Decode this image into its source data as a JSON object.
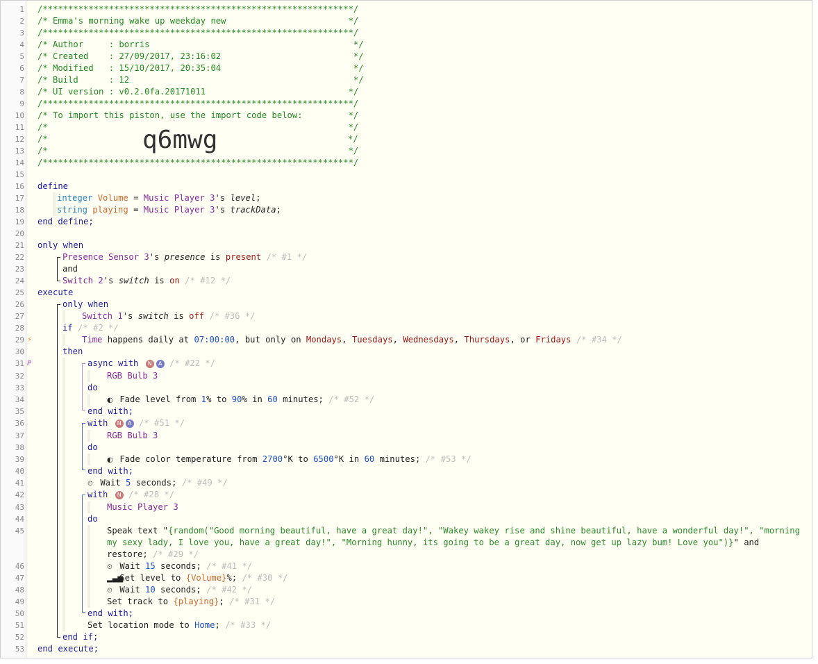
{
  "header": {
    "stars": "/*************************************************************/",
    "title": "/* Emma's morning wake up weekday new                        */",
    "author": "/* Author     : borris                                        */",
    "created": "/* Created    : 27/09/2017, 23:16:02                          */",
    "modified": "/* Modified   : 15/10/2017, 20:35:04                          */",
    "build": "/* Build      : 12                                            */",
    "ui_version": "/* UI version : v0.2.0fa.20171011                            */",
    "import_note": "/* To import this piston, use the import code below:         */",
    "empty_comment": "/*                                                           */",
    "import_prefix": "/*",
    "import_suffix": "*/",
    "import_code": "q6mwg"
  },
  "gutter": {
    "lines": [
      "1",
      "2",
      "3",
      "4",
      "5",
      "6",
      "7",
      "8",
      "9",
      "10",
      "11",
      "12",
      "13",
      "14",
      "15",
      "16",
      "17",
      "18",
      "19",
      "20",
      "21",
      "22",
      "23",
      "24",
      "25",
      "26",
      "27",
      "28",
      "29",
      "30",
      "31",
      "32",
      "33",
      "34",
      "35",
      "36",
      "37",
      "38",
      "39",
      "40",
      "41",
      "42",
      "43",
      "44",
      "45",
      "46",
      "47",
      "48",
      "49",
      "50",
      "51",
      "52",
      "53"
    ],
    "trigger_marker": "⚡",
    "parallel_marker": "P"
  },
  "code": {
    "define": "define",
    "end_define": "end define;",
    "integer": "integer",
    "string": "string",
    "var_volume": "Volume",
    "var_playing": "playing",
    "eq": " = ",
    "music_player_3": "Music Player 3",
    "apos_s": "'s ",
    "attr_level": "level",
    "attr_trackData": "trackData",
    "semi": ";",
    "only_when": "only when",
    "presence_sensor_3": "Presence Sensor 3",
    "attr_presence": "presence",
    "is": " is ",
    "present": "present",
    "c1": " /* #1 */",
    "and": "and",
    "switch_2": "Switch 2",
    "attr_switch": "switch",
    "on": "on",
    "c12": " /* #12 */",
    "execute": "execute",
    "switch_1": "Switch 1",
    "off": "off",
    "c36": " /* #36 */",
    "if": "if",
    "c2": " /* #2 */",
    "time": "Time",
    "happens_daily": " happens daily at ",
    "time_value": "07:00:00",
    "but_only_on": ", but only on ",
    "mon": "Mondays",
    "tue": "Tuesdays",
    "wed": "Wednesdays",
    "thu": "Thursdays",
    "fri": "Fridays",
    "comma": ", ",
    "or": ", or ",
    "c34": " /* #34 */",
    "then": "then",
    "async_with": "async with",
    "badge_n": "N",
    "badge_a": "A",
    "c22": " /* #22 */",
    "rgb_bulb_3": "RGB Bulb 3",
    "do": "do",
    "fade_level": " Fade level from ",
    "v1": "1",
    "pct_to": "% to ",
    "v90": "90",
    "pct_in": "% in ",
    "v60": "60",
    "minutes": " minutes;",
    "c52": " /* #52 */",
    "end_with": "end with;",
    "with": "with",
    "c51": " /* #51 */",
    "fade_color": " Fade color temperature from ",
    "v2700": "2700",
    "k_to": "°K to ",
    "v6500": "6500",
    "k_in": "°K in ",
    "c53": " /* #53 */",
    "wait": " Wait ",
    "v5": "5",
    "seconds": " seconds;",
    "c49": " /* #49 */",
    "c28": " /* #28 */",
    "speak_text": "Speak text \"",
    "speak_expr_1": "{random(\"Good morning beautiful, have a great day!\", \"Wakey wakey rise and shine beautiful, have a wonderful day!\", \"morning",
    "speak_expr_2": "my sexy lady, I love you, have a great day!\", \"Morning hunny, its going to be a great day, now get up lazy bum! Love you\")}",
    "speak_and": "\" and",
    "restore": "restore;",
    "c29": " /* #29 */",
    "v15": "15",
    "c41": " /* #41 */",
    "set_level_to": " Set level to ",
    "volume_expr": "{Volume}",
    "pct_semi": "%;",
    "c30": " /* #30 */",
    "v10": "10",
    "c42": " /* #42 */",
    "set_track_to": "Set track to ",
    "playing_expr": "{playing}",
    "c31": " /* #31 */",
    "set_location_mode": "Set location mode to ",
    "home": "Home",
    "c33": " /* #33 */",
    "end_if": "end if;",
    "end_execute": "end execute;"
  },
  "colors": {
    "comment": "#228b22",
    "keyword": "#1d1d9f",
    "type": "#2a84c2",
    "variable": "#d0682b",
    "device": "#8a2aa0",
    "value": "#9e1414",
    "number": "#1d50c8",
    "statement_id": "#bcbcbc",
    "background": "#fffff3"
  },
  "icons": {
    "fade": "toggle-icon",
    "wait": "clock-icon",
    "level": "signal-bars-icon"
  }
}
